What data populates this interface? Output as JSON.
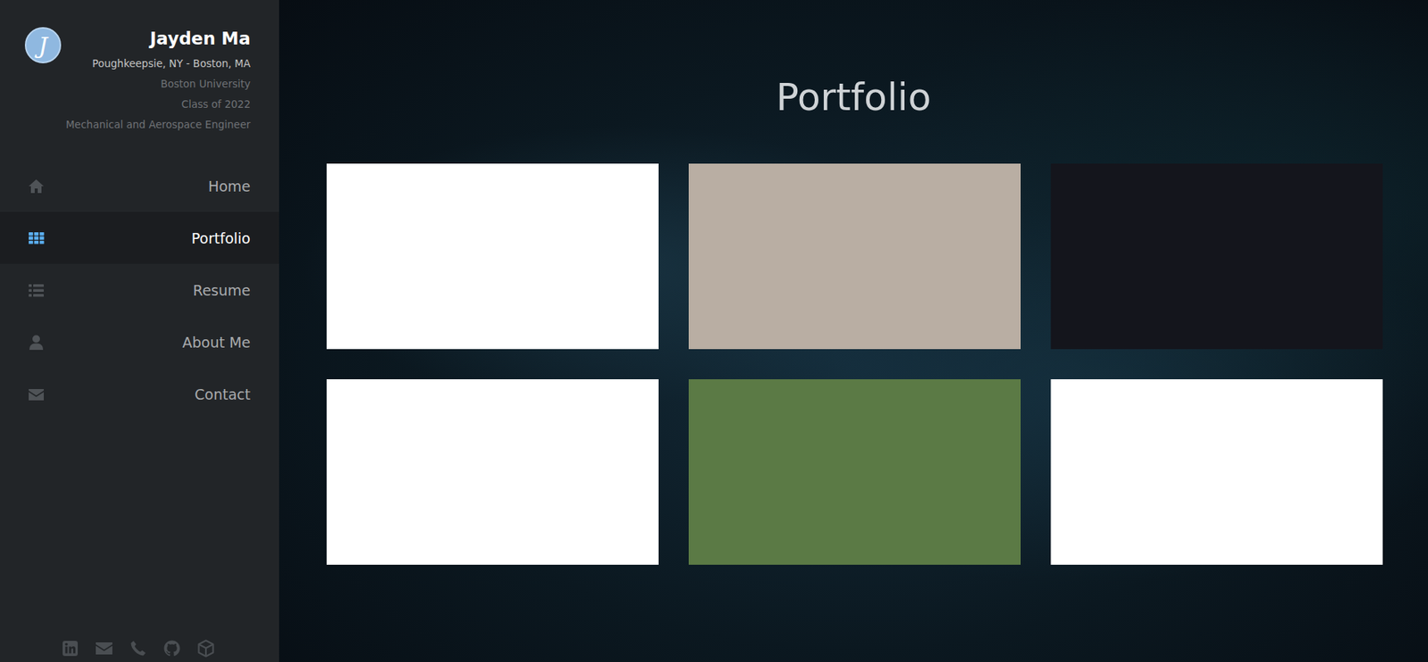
{
  "sidebar": {
    "logo": "J",
    "name": "Jayden Ma",
    "location": "Poughkeepsie, NY - Boston, MA",
    "details": [
      "Boston University",
      "Class of 2022",
      "Mechanical and Aerospace Engineer"
    ],
    "nav": [
      {
        "label": "Home",
        "selected": false
      },
      {
        "label": "Portfolio",
        "selected": true
      },
      {
        "label": "Resume",
        "selected": false
      },
      {
        "label": "About Me",
        "selected": false
      },
      {
        "label": "Contact",
        "selected": false
      }
    ]
  },
  "page": {
    "title": "Portfolio"
  },
  "portfolio": [
    {
      "color": "#ffffff"
    },
    {
      "color": "#b9aea3"
    },
    {
      "color": "#14151c"
    },
    {
      "color": "#ffffff"
    },
    {
      "color": "#5b7a45"
    },
    {
      "color": "#ffffff"
    }
  ]
}
